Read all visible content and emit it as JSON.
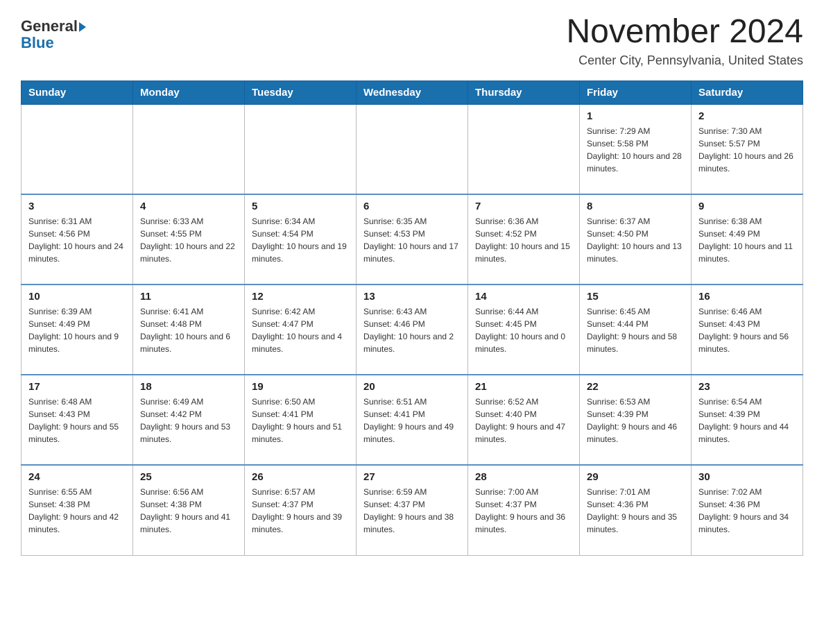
{
  "header": {
    "logo_general": "General",
    "logo_blue": "Blue",
    "month_title": "November 2024",
    "subtitle": "Center City, Pennsylvania, United States"
  },
  "weekdays": [
    "Sunday",
    "Monday",
    "Tuesday",
    "Wednesday",
    "Thursday",
    "Friday",
    "Saturday"
  ],
  "weeks": [
    [
      {
        "day": "",
        "info": ""
      },
      {
        "day": "",
        "info": ""
      },
      {
        "day": "",
        "info": ""
      },
      {
        "day": "",
        "info": ""
      },
      {
        "day": "",
        "info": ""
      },
      {
        "day": "1",
        "info": "Sunrise: 7:29 AM\nSunset: 5:58 PM\nDaylight: 10 hours and 28 minutes."
      },
      {
        "day": "2",
        "info": "Sunrise: 7:30 AM\nSunset: 5:57 PM\nDaylight: 10 hours and 26 minutes."
      }
    ],
    [
      {
        "day": "3",
        "info": "Sunrise: 6:31 AM\nSunset: 4:56 PM\nDaylight: 10 hours and 24 minutes."
      },
      {
        "day": "4",
        "info": "Sunrise: 6:33 AM\nSunset: 4:55 PM\nDaylight: 10 hours and 22 minutes."
      },
      {
        "day": "5",
        "info": "Sunrise: 6:34 AM\nSunset: 4:54 PM\nDaylight: 10 hours and 19 minutes."
      },
      {
        "day": "6",
        "info": "Sunrise: 6:35 AM\nSunset: 4:53 PM\nDaylight: 10 hours and 17 minutes."
      },
      {
        "day": "7",
        "info": "Sunrise: 6:36 AM\nSunset: 4:52 PM\nDaylight: 10 hours and 15 minutes."
      },
      {
        "day": "8",
        "info": "Sunrise: 6:37 AM\nSunset: 4:50 PM\nDaylight: 10 hours and 13 minutes."
      },
      {
        "day": "9",
        "info": "Sunrise: 6:38 AM\nSunset: 4:49 PM\nDaylight: 10 hours and 11 minutes."
      }
    ],
    [
      {
        "day": "10",
        "info": "Sunrise: 6:39 AM\nSunset: 4:49 PM\nDaylight: 10 hours and 9 minutes."
      },
      {
        "day": "11",
        "info": "Sunrise: 6:41 AM\nSunset: 4:48 PM\nDaylight: 10 hours and 6 minutes."
      },
      {
        "day": "12",
        "info": "Sunrise: 6:42 AM\nSunset: 4:47 PM\nDaylight: 10 hours and 4 minutes."
      },
      {
        "day": "13",
        "info": "Sunrise: 6:43 AM\nSunset: 4:46 PM\nDaylight: 10 hours and 2 minutes."
      },
      {
        "day": "14",
        "info": "Sunrise: 6:44 AM\nSunset: 4:45 PM\nDaylight: 10 hours and 0 minutes."
      },
      {
        "day": "15",
        "info": "Sunrise: 6:45 AM\nSunset: 4:44 PM\nDaylight: 9 hours and 58 minutes."
      },
      {
        "day": "16",
        "info": "Sunrise: 6:46 AM\nSunset: 4:43 PM\nDaylight: 9 hours and 56 minutes."
      }
    ],
    [
      {
        "day": "17",
        "info": "Sunrise: 6:48 AM\nSunset: 4:43 PM\nDaylight: 9 hours and 55 minutes."
      },
      {
        "day": "18",
        "info": "Sunrise: 6:49 AM\nSunset: 4:42 PM\nDaylight: 9 hours and 53 minutes."
      },
      {
        "day": "19",
        "info": "Sunrise: 6:50 AM\nSunset: 4:41 PM\nDaylight: 9 hours and 51 minutes."
      },
      {
        "day": "20",
        "info": "Sunrise: 6:51 AM\nSunset: 4:41 PM\nDaylight: 9 hours and 49 minutes."
      },
      {
        "day": "21",
        "info": "Sunrise: 6:52 AM\nSunset: 4:40 PM\nDaylight: 9 hours and 47 minutes."
      },
      {
        "day": "22",
        "info": "Sunrise: 6:53 AM\nSunset: 4:39 PM\nDaylight: 9 hours and 46 minutes."
      },
      {
        "day": "23",
        "info": "Sunrise: 6:54 AM\nSunset: 4:39 PM\nDaylight: 9 hours and 44 minutes."
      }
    ],
    [
      {
        "day": "24",
        "info": "Sunrise: 6:55 AM\nSunset: 4:38 PM\nDaylight: 9 hours and 42 minutes."
      },
      {
        "day": "25",
        "info": "Sunrise: 6:56 AM\nSunset: 4:38 PM\nDaylight: 9 hours and 41 minutes."
      },
      {
        "day": "26",
        "info": "Sunrise: 6:57 AM\nSunset: 4:37 PM\nDaylight: 9 hours and 39 minutes."
      },
      {
        "day": "27",
        "info": "Sunrise: 6:59 AM\nSunset: 4:37 PM\nDaylight: 9 hours and 38 minutes."
      },
      {
        "day": "28",
        "info": "Sunrise: 7:00 AM\nSunset: 4:37 PM\nDaylight: 9 hours and 36 minutes."
      },
      {
        "day": "29",
        "info": "Sunrise: 7:01 AM\nSunset: 4:36 PM\nDaylight: 9 hours and 35 minutes."
      },
      {
        "day": "30",
        "info": "Sunrise: 7:02 AM\nSunset: 4:36 PM\nDaylight: 9 hours and 34 minutes."
      }
    ]
  ]
}
